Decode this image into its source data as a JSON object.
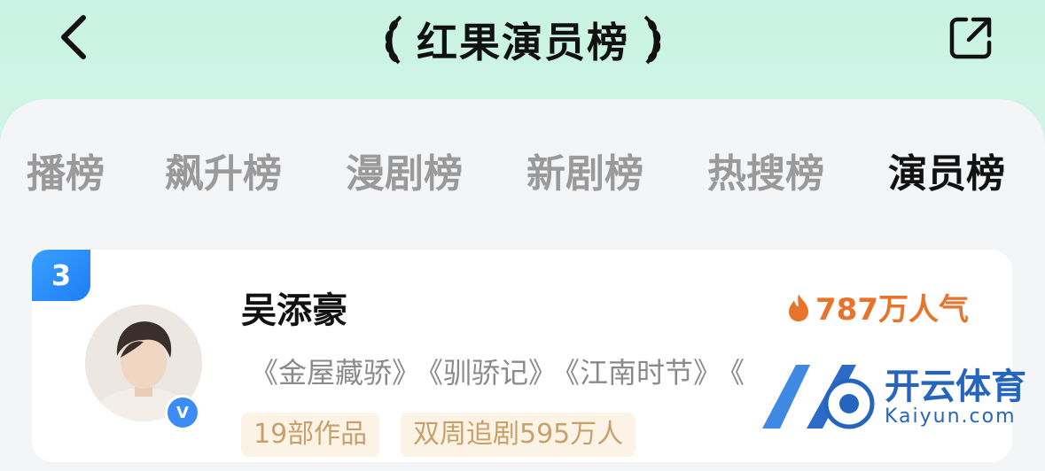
{
  "header": {
    "title": "红果演员榜"
  },
  "tabs": [
    "播榜",
    "飙升榜",
    "漫剧榜",
    "新剧榜",
    "热搜榜",
    "演员榜"
  ],
  "active_tab": "演员榜",
  "card": {
    "rank": "3",
    "name": "吴添豪",
    "popularity": "787万人气",
    "works": [
      "《金屋藏骄》",
      "《驯骄记》",
      "《江南时节》",
      "《"
    ],
    "tags": [
      "19部作品",
      "双周追剧595万人"
    ],
    "verified_label": "V"
  },
  "watermark": {
    "brand": "开云体育",
    "sub": "Kaiyun.com"
  },
  "colors": {
    "accent_orange": "#e8742b",
    "rank_blue": "#1e7ef5",
    "tag_bg": "#fbf3e6"
  }
}
